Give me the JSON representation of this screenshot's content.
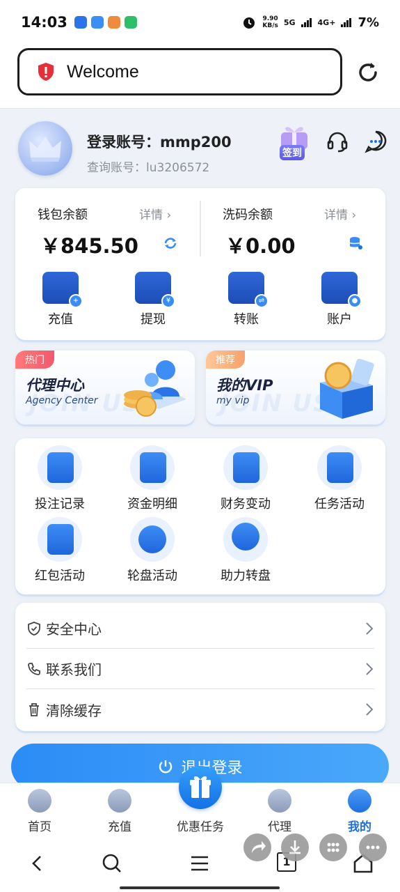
{
  "status_bar": {
    "time": "14:03",
    "speed_value": "9.90",
    "speed_unit": "KB/s",
    "network_5g": "5G",
    "network_4g": "4G+",
    "battery": "7%"
  },
  "browser": {
    "url_text": "Welcome"
  },
  "profile": {
    "account_label": "登录账号：",
    "account_value": "mmp200",
    "query_label": "查询账号：",
    "query_value": "lu3206572",
    "signin_label": "签到"
  },
  "wallet": {
    "balance_label": "钱包余额",
    "balance_detail": "详情 ›",
    "balance_amount": "￥845.50",
    "wash_label": "洗码余额",
    "wash_detail": "详情 ›",
    "wash_amount": "￥0.00",
    "actions": [
      {
        "label": "充值",
        "badge": "+"
      },
      {
        "label": "提现",
        "badge": "¥"
      },
      {
        "label": "转账",
        "badge": "⇌"
      },
      {
        "label": "账户",
        "badge": "●"
      }
    ]
  },
  "promos": [
    {
      "tag": "热门",
      "title": "代理中心",
      "subtitle": "Agency Center",
      "bg_text": "JOIN US"
    },
    {
      "tag": "推荐",
      "title": "我的VIP",
      "subtitle": "my vip",
      "bg_text": "JOIN US"
    }
  ],
  "grid_items": [
    {
      "label": "投注记录",
      "icon": "bet-record-icon"
    },
    {
      "label": "资金明细",
      "icon": "fund-detail-icon"
    },
    {
      "label": "财务变动",
      "icon": "finance-change-icon"
    },
    {
      "label": "任务活动",
      "icon": "task-activity-icon"
    },
    {
      "label": "红包活动",
      "icon": "red-envelope-icon"
    },
    {
      "label": "轮盘活动",
      "icon": "roulette-icon"
    },
    {
      "label": "助力转盘",
      "icon": "wheel-icon"
    }
  ],
  "list_items": [
    {
      "label": "安全中心",
      "icon": "shield-icon"
    },
    {
      "label": "联系我们",
      "icon": "phone-icon"
    },
    {
      "label": "清除缓存",
      "icon": "trash-icon"
    }
  ],
  "logout_label": "退出登录",
  "tabs": [
    {
      "label": "首页",
      "icon": "home-icon"
    },
    {
      "label": "充值",
      "icon": "deposit-icon"
    },
    {
      "label": "优惠任务",
      "icon": "gift-icon"
    },
    {
      "label": "代理",
      "icon": "agent-icon"
    },
    {
      "label": "我的",
      "icon": "user-icon"
    }
  ],
  "active_tab": "我的",
  "browser_nav": {
    "tab_count": "1"
  },
  "colors": {
    "accent": "#1f6fe0",
    "accent_light": "#3a8cf5",
    "danger": "#e5303a"
  }
}
